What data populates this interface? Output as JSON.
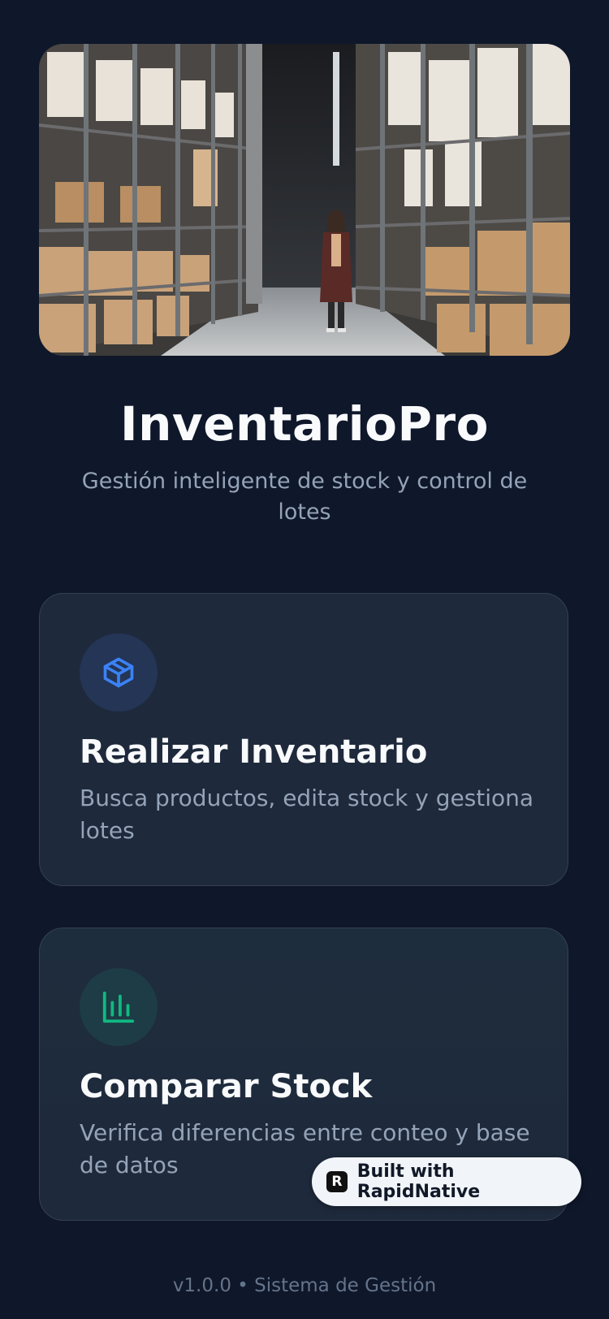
{
  "hero": {
    "image": "warehouse-aisle-photo"
  },
  "app": {
    "title": "InventarioPro",
    "subtitle": "Gestión inteligente de stock y control de lotes"
  },
  "cards": [
    {
      "icon": "box-icon",
      "icon_color": "#3b82f6",
      "title": "Realizar Inventario",
      "description": "Busca productos, edita stock y gestiona lotes"
    },
    {
      "icon": "bar-chart-icon",
      "icon_color": "#10b981",
      "title": "Comparar Stock",
      "description": "Verifica diferencias entre conteo y base de datos"
    }
  ],
  "badge": {
    "label": "Built with RapidNative"
  },
  "footer": {
    "version_text": "v1.0.0 • Sistema de Gestión"
  },
  "colors": {
    "background": "#0f172a",
    "card": "#1e293b",
    "text_primary": "#f8fafc",
    "text_secondary": "#94a3b8"
  }
}
